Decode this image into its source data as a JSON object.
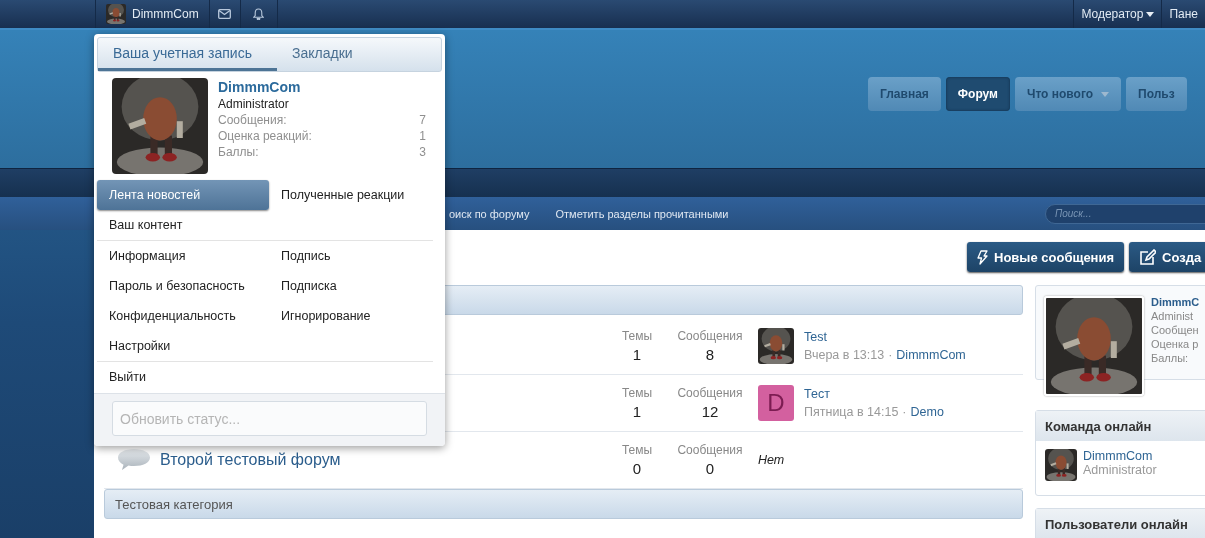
{
  "top_bar": {
    "user": "DimmmCom",
    "right_items": [
      {
        "label": "Модератор",
        "caret": true
      },
      {
        "label": "Пане",
        "caret": false
      }
    ]
  },
  "nav_tabs": [
    {
      "label": "Главная",
      "selected": false,
      "caret": false
    },
    {
      "label": "Форум",
      "selected": true,
      "caret": false
    },
    {
      "label": "Что нового",
      "selected": false,
      "caret": true
    },
    {
      "label": "Польз",
      "selected": false,
      "caret": false
    }
  ],
  "sub_nav": {
    "links": [
      "оиск по форуму",
      "Отметить разделы прочитанными"
    ],
    "search": {
      "placeholder": "Поиск..."
    }
  },
  "actions": [
    {
      "label": "Новые сообщения",
      "kind": "new_posts"
    },
    {
      "label": "Созда",
      "kind": "create"
    }
  ],
  "sections": [
    {
      "kind": "category"
    },
    {
      "kind": "forum",
      "stats": [
        {
          "label": "Темы",
          "value": "1"
        },
        {
          "label": "Сообщения",
          "value": "8"
        }
      ],
      "last_post": {
        "title": "Test",
        "date": "Вчера в 13:13",
        "separator": "·",
        "author": "DimmmCom"
      }
    },
    {
      "kind": "forum",
      "stats": [
        {
          "label": "Темы",
          "value": "1"
        },
        {
          "label": "Сообщения",
          "value": "12"
        }
      ],
      "last_post": {
        "letter": "D",
        "color": "#d3609f",
        "title": "Тест",
        "date": "Пятница в 14:15",
        "separator": "·",
        "author": "Demo"
      }
    },
    {
      "kind": "forum",
      "title": "Второй тестовый форум",
      "stats": [
        {
          "label": "Темы",
          "value": "0"
        },
        {
          "label": "Сообщения",
          "value": "0"
        }
      ],
      "none_text": "Нет"
    },
    {
      "kind": "category",
      "title": "Тестовая категория"
    }
  ],
  "sidebar": {
    "profile": {
      "name": "DimmmC",
      "lines": [
        "Administ",
        "Сообщен",
        "Оценка р",
        "Баллы:"
      ]
    },
    "staff_online": {
      "title": "Команда онлайн",
      "members": [
        {
          "name": "DimmmCom",
          "role": "Administrator"
        }
      ]
    },
    "users_online": {
      "title": "Пользователи онлайн"
    }
  },
  "account_menu": {
    "tabs": [
      {
        "label": "Ваша учетная запись",
        "selected": true
      },
      {
        "label": "Закладки",
        "selected": false
      }
    ],
    "profile": {
      "name": "DimmmCom",
      "role": "Administrator",
      "stats": [
        {
          "label": "Сообщения:",
          "value": "7"
        },
        {
          "label": "Оценка реакций:",
          "value": "1"
        },
        {
          "label": "Баллы:",
          "value": "3"
        }
      ]
    },
    "groups": [
      [
        {
          "label": "Лента новостей",
          "selected": true
        },
        {
          "label": "Полученные реакции",
          "selected": false
        },
        {
          "label": "Ваш контент",
          "selected": false
        }
      ],
      [
        {
          "label": "Информация",
          "selected": false
        },
        {
          "label": "Подпись",
          "selected": false
        },
        {
          "label": "Пароль и безопасность",
          "selected": false
        },
        {
          "label": "Подписка",
          "selected": false
        },
        {
          "label": "Конфиденциальность",
          "selected": false
        },
        {
          "label": "Игнорирование",
          "selected": false
        },
        {
          "label": "Настройки",
          "selected": false
        }
      ],
      [
        {
          "label": "Выйти",
          "selected": false
        }
      ]
    ],
    "status": {
      "placeholder": "Обновить статус..."
    }
  }
}
